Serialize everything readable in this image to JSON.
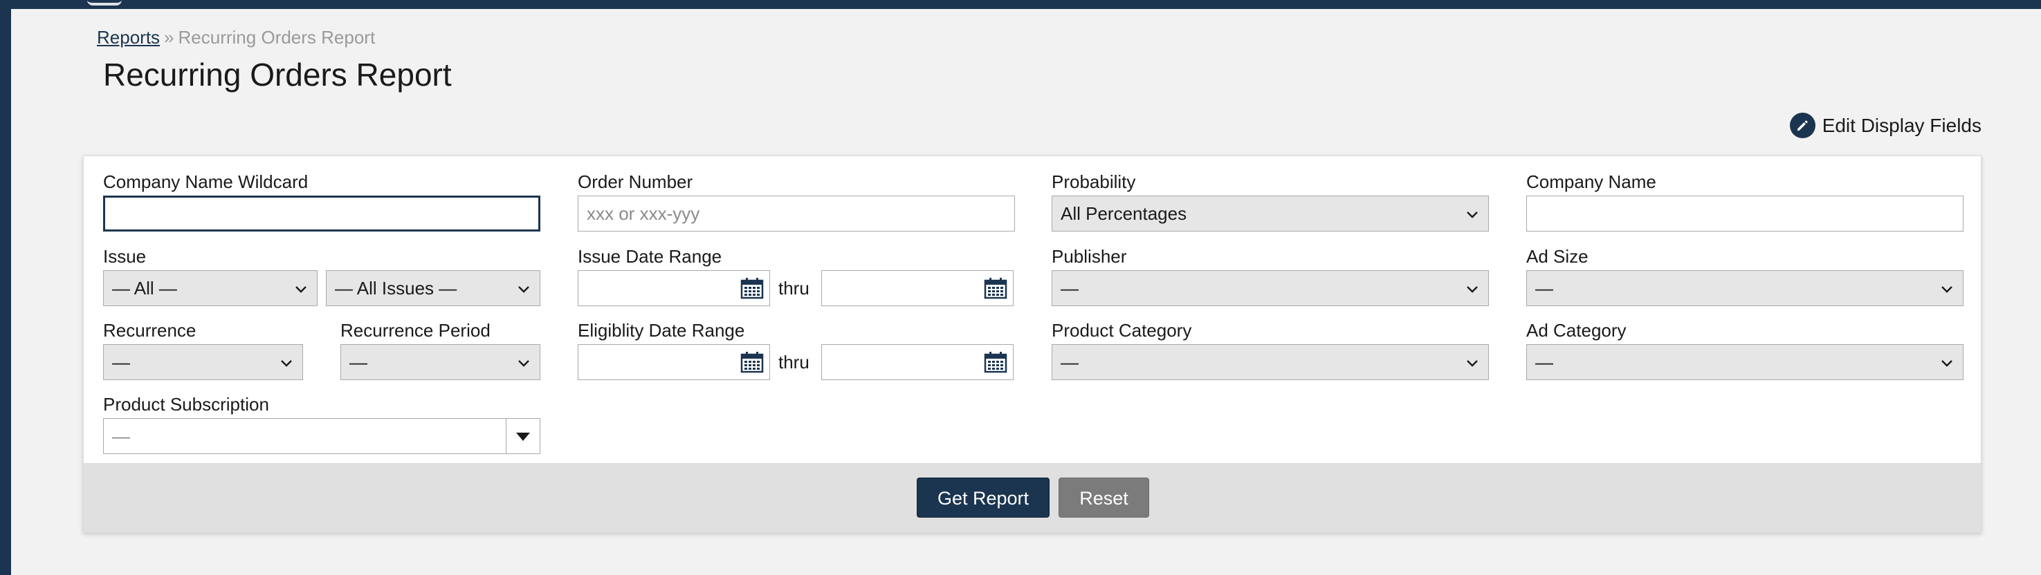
{
  "breadcrumb": {
    "root": "Reports",
    "separator": "»",
    "current": "Recurring Orders Report"
  },
  "page": {
    "title": "Recurring Orders Report"
  },
  "toolbar": {
    "edit_display_fields": "Edit Display Fields",
    "edit_icon": "pencil-icon"
  },
  "form": {
    "company_name_wildcard": {
      "label": "Company Name Wildcard",
      "value": ""
    },
    "order_number": {
      "label": "Order Number",
      "placeholder": "xxx or xxx-yyy",
      "value": ""
    },
    "probability": {
      "label": "Probability",
      "value": "All Percentages"
    },
    "company_name": {
      "label": "Company Name",
      "value": ""
    },
    "issue": {
      "label": "Issue",
      "value1": "— All —",
      "value2": "— All Issues —"
    },
    "issue_date_range": {
      "label": "Issue Date Range",
      "thru": "thru"
    },
    "publisher": {
      "label": "Publisher",
      "value": "—"
    },
    "ad_size": {
      "label": "Ad Size",
      "value": "—"
    },
    "recurrence": {
      "label": "Recurrence",
      "value": "—"
    },
    "recurrence_period": {
      "label": "Recurrence Period",
      "value": "—"
    },
    "eligibility_date_range": {
      "label": "Eligiblity Date Range",
      "thru": "thru"
    },
    "product_category": {
      "label": "Product Category",
      "value": "—"
    },
    "ad_category": {
      "label": "Ad Category",
      "value": "—"
    },
    "product_subscription": {
      "label": "Product Subscription",
      "value": "—"
    }
  },
  "actions": {
    "get_report": "Get Report",
    "reset": "Reset"
  },
  "colors": {
    "brand": "#1b3550",
    "secondary_button": "#7b7b7b",
    "footer": "#e0e0e0",
    "page_bg": "#f2f2f2"
  }
}
